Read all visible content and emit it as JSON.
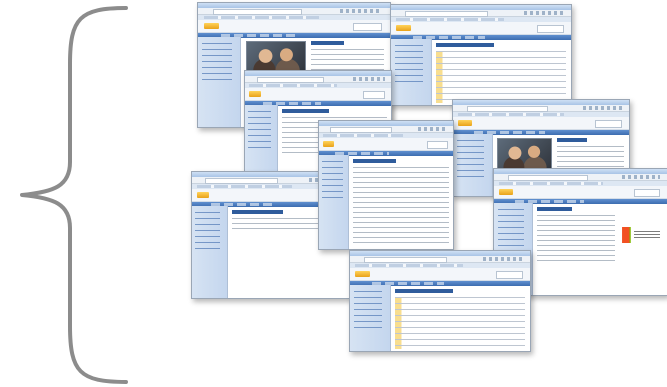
{
  "brace": {
    "color": "#8c8c8c",
    "shape": "left-curly-brace"
  },
  "screenshots": [
    {
      "id": "shot-1",
      "kind": "welcome-photo"
    },
    {
      "id": "shot-2",
      "kind": "document-library"
    },
    {
      "id": "shot-3",
      "kind": "links-list"
    },
    {
      "id": "shot-4",
      "kind": "text-article"
    },
    {
      "id": "shot-5",
      "kind": "welcome-photo"
    },
    {
      "id": "shot-6",
      "kind": "blank-team-site"
    },
    {
      "id": "shot-7",
      "kind": "logo-site"
    },
    {
      "id": "shot-8",
      "kind": "document-library"
    }
  ],
  "colors": {
    "left_nav": "#c4d6ee",
    "nav_bar": "#3c6db0",
    "title_text": "#2f5c9c",
    "folder_icon": "#e8a21a"
  }
}
